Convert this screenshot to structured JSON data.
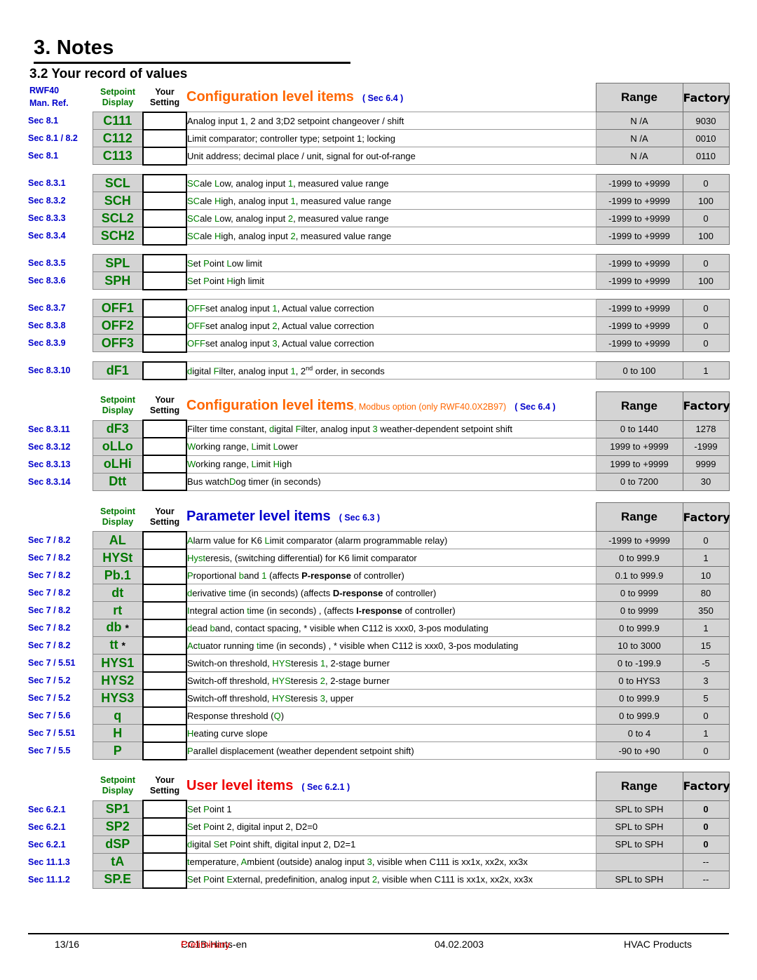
{
  "document": {
    "chapter_title": "3. Notes",
    "section_title": "3.2 Your record of values",
    "manual_ref_label_line1": "RWF40",
    "manual_ref_label_line2": "Man. Ref."
  },
  "column_headers": {
    "setpoint": "Setpoint",
    "display": "Display",
    "your": "Your",
    "setting": "Setting",
    "range": "Range",
    "factory": "Factory"
  },
  "sections": [
    {
      "id": "configuration",
      "title": "Configuration level items",
      "title_color": "#FF6600",
      "subtitle": "",
      "sec_ref": "( Sec 6.4 )",
      "groups": [
        {
          "rows": [
            {
              "sec": "Sec 8.1",
              "display": "C111",
              "desc": "Analog input 1, 2 and 3;D2 setpoint changeover / shift",
              "range": "N /A",
              "factory": "9030"
            },
            {
              "sec": "Sec 8.1 / 8.2",
              "display": "C112",
              "desc": "Limit comparator; controller type; setpoint 1; locking",
              "range": "N /A",
              "factory": "0010"
            },
            {
              "sec": "Sec 8.1",
              "display": "C113",
              "desc": "Unit address; decimal place / unit, signal for out-of-range",
              "range": "N /A",
              "factory": "0110"
            }
          ]
        },
        {
          "rows": [
            {
              "sec": "Sec 8.3.1",
              "display": "SCL",
              "desc": "SCale Low, analog input 1, measured value range",
              "range": "-1999  to +9999",
              "factory": "0"
            },
            {
              "sec": "Sec 8.3.2",
              "display": "SCH",
              "desc": "SCale High, analog input 1, measured value range",
              "range": "-1999  to +9999",
              "factory": "100"
            },
            {
              "sec": "Sec 8.3.3",
              "display": "SCL2",
              "desc": "SCale Low, analog input 2, measured value range",
              "range": "-1999  to +9999",
              "factory": "0"
            },
            {
              "sec": "Sec 8.3.4",
              "display": "SCH2",
              "desc": "SCale High, analog input 2, measured value range",
              "range": "-1999  to +9999",
              "factory": "100"
            }
          ]
        },
        {
          "rows": [
            {
              "sec": "Sec 8.3.5",
              "display": "SPL",
              "desc": "Set Point Low limit",
              "range": "-1999  to +9999",
              "factory": "0"
            },
            {
              "sec": "Sec 8.3.6",
              "display": "SPH",
              "desc": "Set Point High limit",
              "range": "-1999  to +9999",
              "factory": "100"
            }
          ]
        },
        {
          "rows": [
            {
              "sec": "Sec 8.3.7",
              "display": "OFF1",
              "desc": "OFFset analog input 1, Actual value correction",
              "range": "-1999  to +9999",
              "factory": "0"
            },
            {
              "sec": "Sec 8.3.8",
              "display": "OFF2",
              "desc": "OFFset analog input 2, Actual value correction",
              "range": "-1999  to +9999",
              "factory": "0"
            },
            {
              "sec": "Sec 8.3.9",
              "display": "OFF3",
              "desc": "OFFset analog input 3, Actual value correction",
              "range": "-1999  to +9999",
              "factory": "0"
            }
          ]
        },
        {
          "rows": [
            {
              "sec": "Sec 8.3.10",
              "display": "dF1",
              "desc": "digital Filter, analog input 1, 2nd order, in seconds",
              "range": "0   to  100",
              "factory": "1"
            }
          ]
        }
      ]
    },
    {
      "id": "configuration-modbus",
      "title": "Configuration level items",
      "title_color": "#FF6600",
      "subtitle": ", Modbus option (only RWF40.0X2B97)",
      "sec_ref": "( Sec 6.4 )",
      "groups": [
        {
          "rows": [
            {
              "sec": "Sec 8.3.11",
              "display": "dF3",
              "desc": "Filter time constant, digital Filter, analog input 3  weather-dependent setpoint shift",
              "range": "0   to  1440",
              "factory": "1278"
            },
            {
              "sec": "Sec 8.3.12",
              "display": "oLLo",
              "desc": "Working range, Limit Lower",
              "range": "1999  to +9999",
              "factory": "-1999"
            },
            {
              "sec": "Sec 8.3.13",
              "display": "oLHi",
              "desc": "Working range, Limit High",
              "range": "1999  to +9999",
              "factory": "9999"
            },
            {
              "sec": "Sec 8.3.14",
              "display": "Dtt",
              "desc": "Bus watchDog timer (in seconds)",
              "range": "0   to  7200",
              "factory": "30"
            }
          ]
        }
      ]
    },
    {
      "id": "parameter",
      "title": "Parameter level items",
      "title_color": "#0000CC",
      "subtitle": "",
      "sec_ref": "( Sec 6.3 )",
      "groups": [
        {
          "rows": [
            {
              "sec": "Sec 7 / 8.2",
              "display": "AL",
              "desc": "Alarm value for K6 Limit comparator (alarm programmable relay)",
              "range": "-1999  to +9999",
              "factory": "0"
            },
            {
              "sec": "Sec 7 / 8.2",
              "display": "HYSt",
              "desc": "Hysteresis, (switching differential) for K6 limit comparator",
              "range": "0  to  999.9",
              "factory": "1"
            },
            {
              "sec": "Sec 7 / 8.2",
              "display": "Pb.1",
              "desc": "Proportional band 1 (affects P-response of controller)",
              "range": "0.1  to   999.9",
              "factory": "10"
            },
            {
              "sec": "Sec 7 / 8.2",
              "display": "dt",
              "desc": "derivative time (in seconds) (affects D-response of controller)",
              "range": "0    to   9999",
              "factory": "80"
            },
            {
              "sec": "Sec 7 / 8.2",
              "display": "rt",
              "desc": "Integral action time (in seconds) , (affects I-response of controller)",
              "range": "0    to   9999",
              "factory": "350"
            },
            {
              "sec": "Sec 7 / 8.2",
              "display": "db *",
              "desc": "dead band, contact spacing, * visible when C112 is xxx0, 3-pos modulating",
              "range": "0  to  999.9",
              "factory": "1"
            },
            {
              "sec": "Sec 7 / 8.2",
              "display": "tt *",
              "desc": "Actuator running time (in seconds) , * visible when C112 is xxx0, 3-pos modulating",
              "range": "10    to    3000",
              "factory": "15"
            },
            {
              "sec": "Sec 7 / 5.51",
              "display": "HYS1",
              "desc": "Switch-on threshold, HYSteresis 1, 2-stage burner",
              "range": "0   to  -199.9",
              "factory": "-5"
            },
            {
              "sec": "Sec 7 / 5.2",
              "display": "HYS2",
              "desc": "Switch-off threshold, HYSteresis 2, 2-stage burner",
              "range": "0  to HYS3",
              "factory": "3"
            },
            {
              "sec": "Sec 7 / 5.2",
              "display": "HYS3",
              "desc": "Switch-off threshold, HYSteresis 3, upper",
              "range": "0   to  999.9",
              "factory": "5"
            },
            {
              "sec": "Sec 7 / 5.6",
              "display": "q",
              "desc": "Response threshold (Q)",
              "range": "0   to  999.9",
              "factory": "0"
            },
            {
              "sec": "Sec 7 / 5.51",
              "display": "H",
              "desc": "Heating curve slope",
              "range": "0   to   4",
              "factory": "1"
            },
            {
              "sec": "Sec 7 / 5.5",
              "display": "P",
              "desc": "Parallel displacement (weather dependent setpoint shift)",
              "range": "-90   to   +90",
              "factory": "0"
            }
          ]
        }
      ]
    },
    {
      "id": "user",
      "title": "User level items",
      "title_color": "#EE0000",
      "subtitle": "",
      "sec_ref": "( Sec 6.2.1 )",
      "groups": [
        {
          "rows": [
            {
              "sec": "Sec 6.2.1",
              "display": "SP1",
              "desc": "Set Point 1",
              "range": "SPL to SPH",
              "factory": "0"
            },
            {
              "sec": "Sec 6.2.1",
              "display": "SP2",
              "desc": "Set Point 2, digital input 2, D2=0",
              "range": "SPL to SPH",
              "factory": "0"
            },
            {
              "sec": "Sec 6.2.1",
              "display": "dSP",
              "desc": "digital Set Point shift, digital input 2, D2=1",
              "range": "SPL to SPH",
              "factory": "0"
            },
            {
              "sec": "Sec 11.1.3",
              "display": "tA",
              "desc": "temperature, Ambient (outside) analog input 3, visible when C111 is xx1x, xx2x, xx3x",
              "range": "",
              "factory": "--"
            },
            {
              "sec": "Sec 11.1.2",
              "display": "SP.E",
              "desc": "Set Point External, predefinition, analog input 2, visible when C111 is xx1x, xx2x, xx3x",
              "range": "SPL to SPH",
              "factory": "--"
            }
          ]
        }
      ]
    }
  ],
  "footer": {
    "page": "13/16",
    "doc_id": "CC1B-Hints-en ",
    "status": "Preliminary",
    "date": "04.02.2003",
    "product": "HVAC Products"
  },
  "colors": {
    "display_green": "#007700",
    "sec_blue": "#0000CC",
    "orange": "#FF6600",
    "red": "#EE0000",
    "gray_fill": "#d4d4d4"
  }
}
